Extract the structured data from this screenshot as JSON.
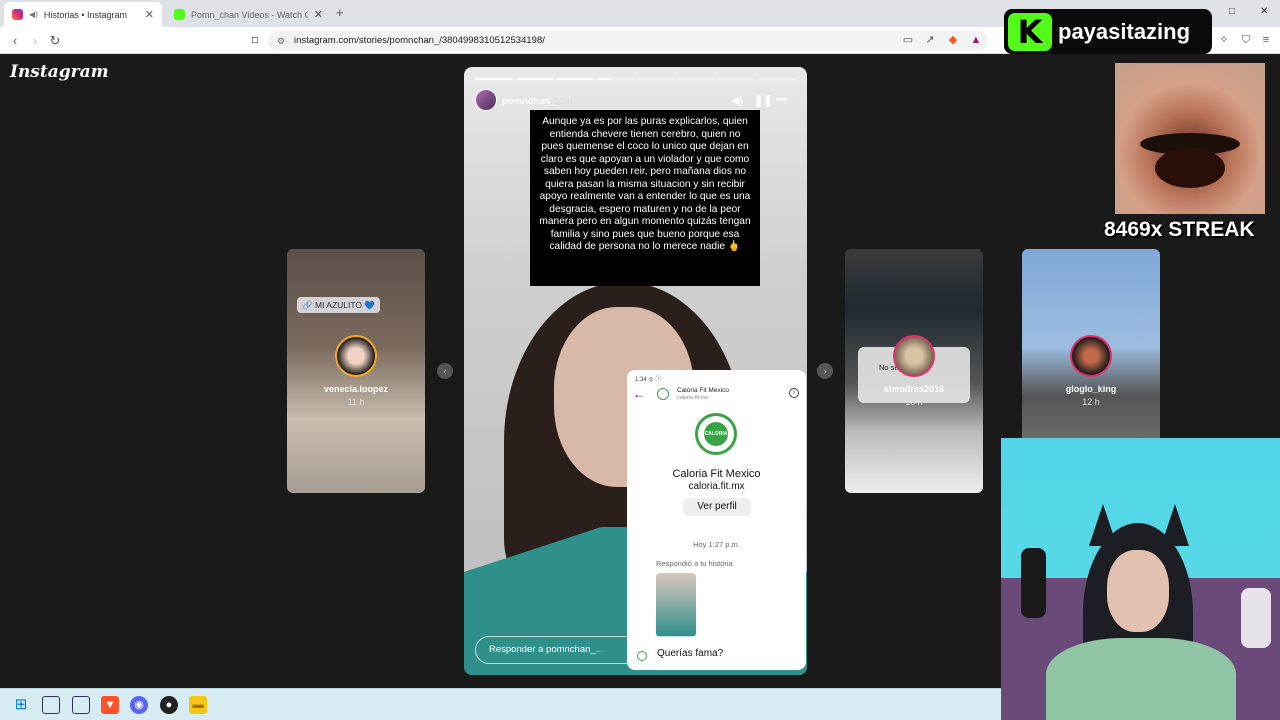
{
  "browser": {
    "tabs": [
      {
        "title": "Historias • Instagram",
        "active": true
      },
      {
        "title": "Pomn_chan Videos - Watch On-Dem",
        "active": false
      }
    ],
    "new_tab": "+",
    "url": "instagram.com/stories/pomnchan_/3804998310512534198/",
    "window_controls": {
      "minimize": "–",
      "maximize": "□",
      "close": "✕"
    }
  },
  "kick_overlay": {
    "logo_letter": "K",
    "channel": "payasitazing",
    "brand_color": "#53fc18"
  },
  "instagram": {
    "logo": "Instagram",
    "story": {
      "username": "pomnchan_",
      "time": "12 h",
      "progress": {
        "total": 8,
        "completed": 3,
        "current_fraction": 0.3
      },
      "caption": "Aunque ya es por las puras explicarlos, quien entienda chevere tienen cerebro, quien no pues quemense el coco lo unico que dejan en claro es que apoyan a un violador y que como saben hoy pueden reir, pero mañana dios no quiera pasan la misma situacion y sin recibir apoyo realmente van a entender lo que es una desgracia, espero maturen y no de la peor manera pero en algun momento quizás tengan familia y sino pues que bueno porque esa calidad de persona no lo merece nadie 🖕",
      "reply_placeholder": "Responder a pomnchan_...",
      "embedded_screenshot": {
        "status": "1:34 ◎ ⓘ",
        "profile_name": "Caloria Fit Mexico",
        "profile_url": "caloria.fit.mx",
        "logo_text": "CALORIA FIT",
        "title": "Caloria Fit Mexico",
        "handle": "caloria.fit.mx",
        "button": "Ver perfil",
        "timestamp": "Hoy 1:27 p.m.",
        "replied_label": "Respondió a tu historia",
        "message": "Querías fama?"
      }
    },
    "side_stories": [
      {
        "username": "venecia.loopez",
        "time": "11 h",
        "tag": "🔗 MI AZULITO 💙"
      },
      {
        "username": "elmodres2016",
        "time": "10 h",
        "overlay_text": "No sé ... er xd"
      },
      {
        "username": "gloglo_king",
        "time": "12 h"
      }
    ]
  },
  "stream_overlay": {
    "streak_text": "8469x STREAK"
  },
  "taskbar": {
    "items": [
      "windows-start",
      "task-view",
      "widgets",
      "brave",
      "discord",
      "obs",
      "file-explorer"
    ]
  }
}
